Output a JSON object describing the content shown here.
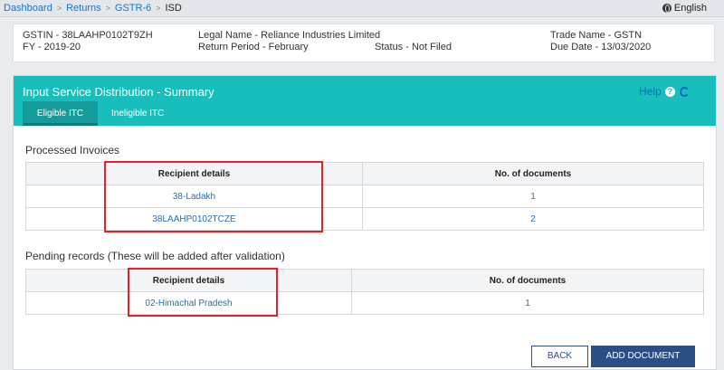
{
  "breadcrumb": {
    "items": [
      "Dashboard",
      "Returns",
      "GSTR-6"
    ],
    "current": "ISD",
    "separator": ">"
  },
  "language": "English",
  "info": {
    "gstin": "GSTIN - 38LAAHP0102T9ZH",
    "fy": "FY - 2019-20",
    "legal_name": "Legal Name - Reliance Industries Limited",
    "return_period": "Return Period - February",
    "status": "Status - Not Filed",
    "trade_name": "Trade Name - GSTN",
    "due_date": "Due Date - 13/03/2020"
  },
  "panel": {
    "title": "Input Service Distribution - Summary",
    "help": "Help",
    "help_q": "?",
    "tabs": [
      "Eligible ITC",
      "Ineligible ITC"
    ]
  },
  "processed": {
    "title": "Processed Invoices",
    "headers": [
      "Recipient details",
      "No. of documents"
    ],
    "rows": [
      {
        "recipient": "38-Ladakh",
        "count": "1"
      },
      {
        "recipient": "38LAAHP0102TCZE",
        "count": "2"
      }
    ]
  },
  "pending": {
    "title": "Pending records (These will be added after validation)",
    "headers": [
      "Recipient details",
      "No. of documents"
    ],
    "rows": [
      {
        "recipient": "02-Himachal Pradesh",
        "count": "1"
      }
    ]
  },
  "buttons": {
    "back": "BACK",
    "add": "ADD DOCUMENT"
  },
  "colors": {
    "header_teal": "#17bebb",
    "link_blue": "#2a6db0",
    "button_navy": "#2c4e86",
    "highlight_red": "#e2232a"
  }
}
